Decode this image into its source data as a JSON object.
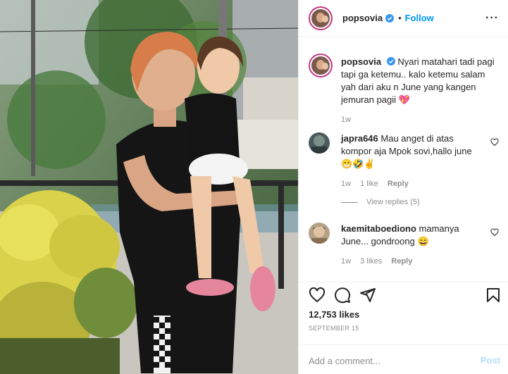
{
  "header": {
    "username": "popsovia",
    "dot": "•",
    "follow_label": "Follow",
    "more_label": "···"
  },
  "caption": {
    "username": "popsovia",
    "text": "Nyari matahari tadi pagi tapi ga ketemu.. kalo ketemu salam yah dari aku n June yang kangen jemuran pagii",
    "emoji": "💖",
    "time": "1w"
  },
  "comments": [
    {
      "username": "japra646",
      "text": "Mau anget di atas kompor aja Mpok sovi,hallo june",
      "emoji": "😁🤣✌",
      "time": "1w",
      "likes": "1 like",
      "reply": "Reply",
      "view_replies": "View replies (5)"
    },
    {
      "username": "kaemitaboediono",
      "text": "mamanya June... gondroong",
      "emoji": "😄",
      "time": "1w",
      "likes": "3 likes",
      "reply": "Reply"
    }
  ],
  "actions": {
    "likes": "12,753 likes",
    "date": "SEPTEMBER 15",
    "icons": [
      "heart-icon",
      "comment-icon",
      "share-icon",
      "bookmark-icon"
    ]
  },
  "add_comment": {
    "placeholder": "Add a comment...",
    "post_label": "Post"
  },
  "colors": {
    "link": "#0095f6",
    "secondary_text": "#8e8e8e",
    "post_disabled": "#b2dffc",
    "verified": "#3897f0"
  }
}
